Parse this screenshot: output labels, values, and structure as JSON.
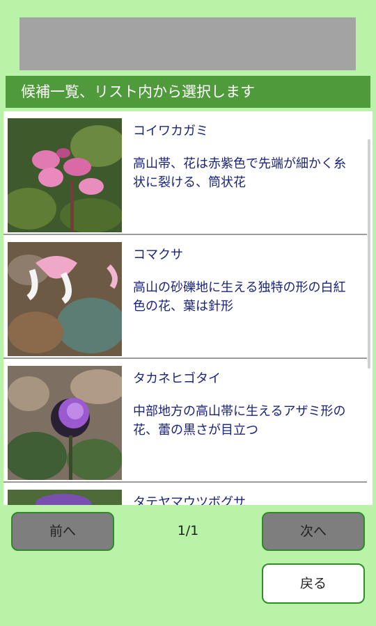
{
  "header": {
    "title": "候補一覧、リスト内から選択します"
  },
  "items": [
    {
      "name": "コイワカガミ",
      "description": "高山帯、花は赤紫色で先端が細かく糸状に裂ける、筒状花"
    },
    {
      "name": "コマクサ",
      "description": "高山の砂礫地に生える独特の形の白紅色の花、葉は針形"
    },
    {
      "name": "タカネヒゴタイ",
      "description": "中部地方の高山帯に生えるアザミ形の花、蕾の黒さが目立つ"
    },
    {
      "name": "タテヤマウツボグサ",
      "description": ""
    }
  ],
  "pagination": {
    "prev_label": "前へ",
    "next_label": "次へ",
    "page_text": "1/1"
  },
  "back_label": "戻る",
  "colors": {
    "background": "#b8f3a8",
    "header": "#4f9a3a",
    "text": "#1a237e",
    "button": "#7e7e7e",
    "button_border": "#2f8a2a"
  }
}
